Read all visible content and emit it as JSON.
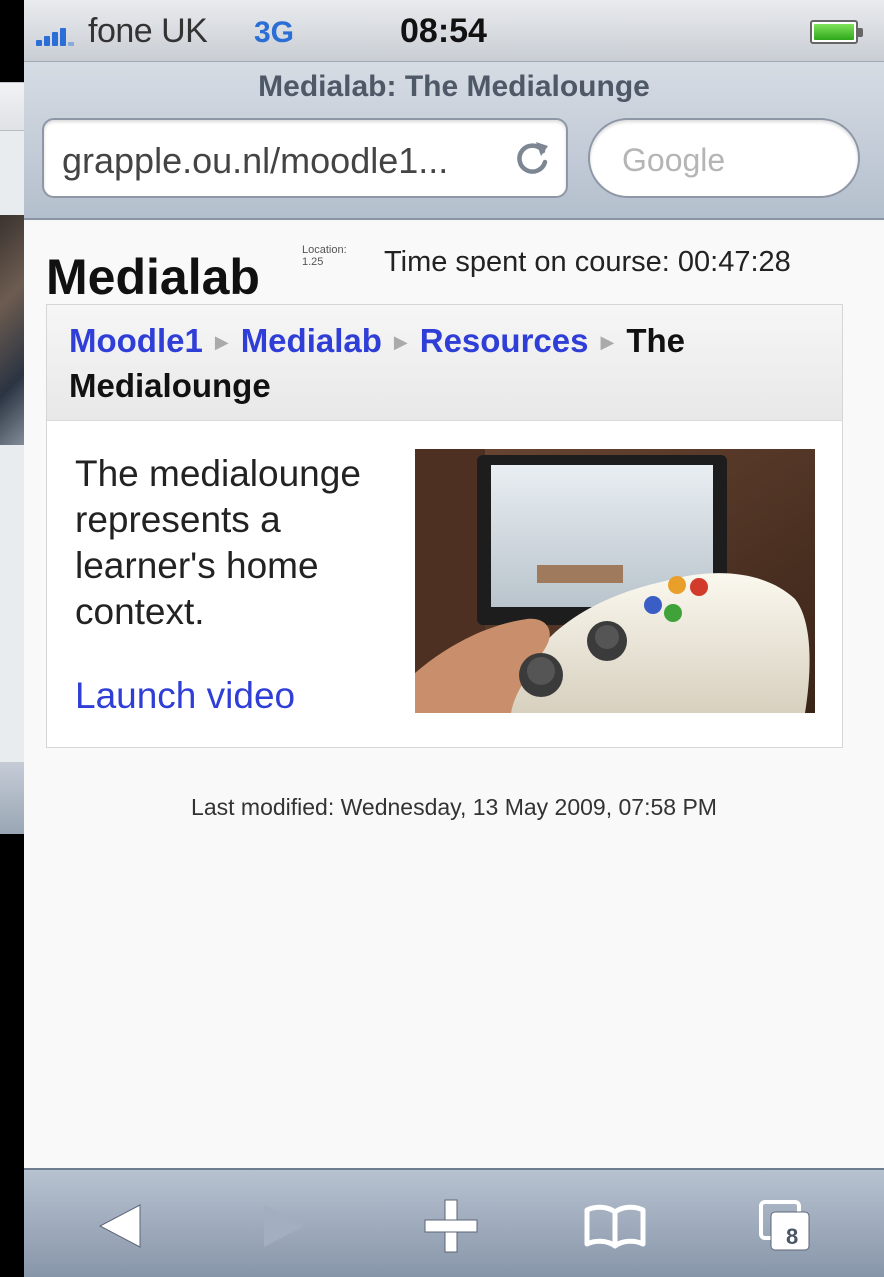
{
  "status_bar": {
    "carrier": "fone UK",
    "network": "3G",
    "time": "08:54"
  },
  "browser": {
    "page_title": "Medialab: The Medialounge",
    "url": "grapple.ou.nl/moodle1...",
    "search_placeholder": "Google",
    "tabs_count": "8"
  },
  "page": {
    "course_title": "Medialab",
    "location_label": "Location:",
    "location_value": "1.25",
    "time_spent": "Time spent on course: 00:47:28",
    "breadcrumb": {
      "item1": "Moodle1",
      "item2": "Medialab",
      "item3": "Resources",
      "current": "The Medialounge"
    },
    "description": "The medialounge represents a learner's home context.",
    "launch_link": "Launch video",
    "last_modified": "Last modified: Wednesday, 13 May 2009, 07:58 PM"
  },
  "icons": {
    "reload": "reload-icon",
    "back": "back-arrow-icon",
    "forward": "forward-arrow-icon",
    "add": "plus-icon",
    "bookmarks": "open-book-icon",
    "pages": "pages-icon"
  },
  "colors": {
    "link": "#2f3ed6",
    "network": "#2b6fd6",
    "battery": "#2fa81c"
  }
}
